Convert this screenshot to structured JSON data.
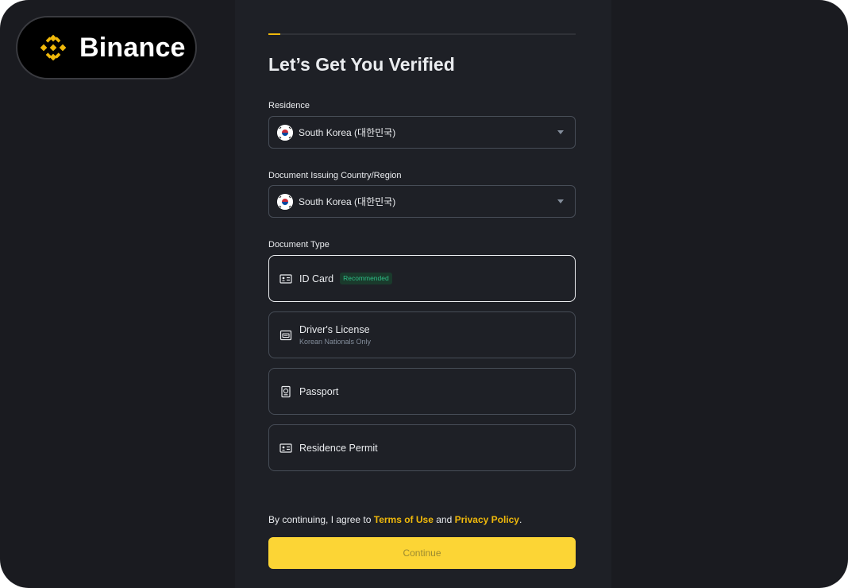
{
  "brand": {
    "name": "Binance",
    "logo_icon": "binance-diamond-logo",
    "accent": "#f0b90b"
  },
  "progress": {
    "fraction": 0.04
  },
  "page": {
    "title": "Let’s Get You Verified"
  },
  "residence": {
    "label": "Residence",
    "value": "South Korea (대한민국)",
    "flag_icon": "south-korea-flag-icon"
  },
  "issuing_country": {
    "label": "Document Issuing Country/Region",
    "value": "South Korea (대한민국)",
    "flag_icon": "south-korea-flag-icon"
  },
  "document_type": {
    "label": "Document Type",
    "options": [
      {
        "title": "ID Card",
        "badge": "Recommended",
        "icon": "id-card-icon",
        "selected": true
      },
      {
        "title": "Driver's License",
        "subtitle": "Korean Nationals Only",
        "icon": "drivers-license-icon",
        "selected": false
      },
      {
        "title": "Passport",
        "icon": "passport-icon",
        "selected": false
      },
      {
        "title": "Residence Permit",
        "icon": "residence-permit-icon",
        "selected": false
      }
    ]
  },
  "consent": {
    "prefix": "By continuing, I agree to ",
    "terms": "Terms of Use",
    "middle": " and ",
    "privacy": "Privacy Policy",
    "suffix": "."
  },
  "actions": {
    "continue_label": "Continue"
  },
  "colors": {
    "background": "#1a1b20",
    "panel": "#1e2026",
    "button": "#fcd535",
    "badge_text": "#2ebd85"
  }
}
